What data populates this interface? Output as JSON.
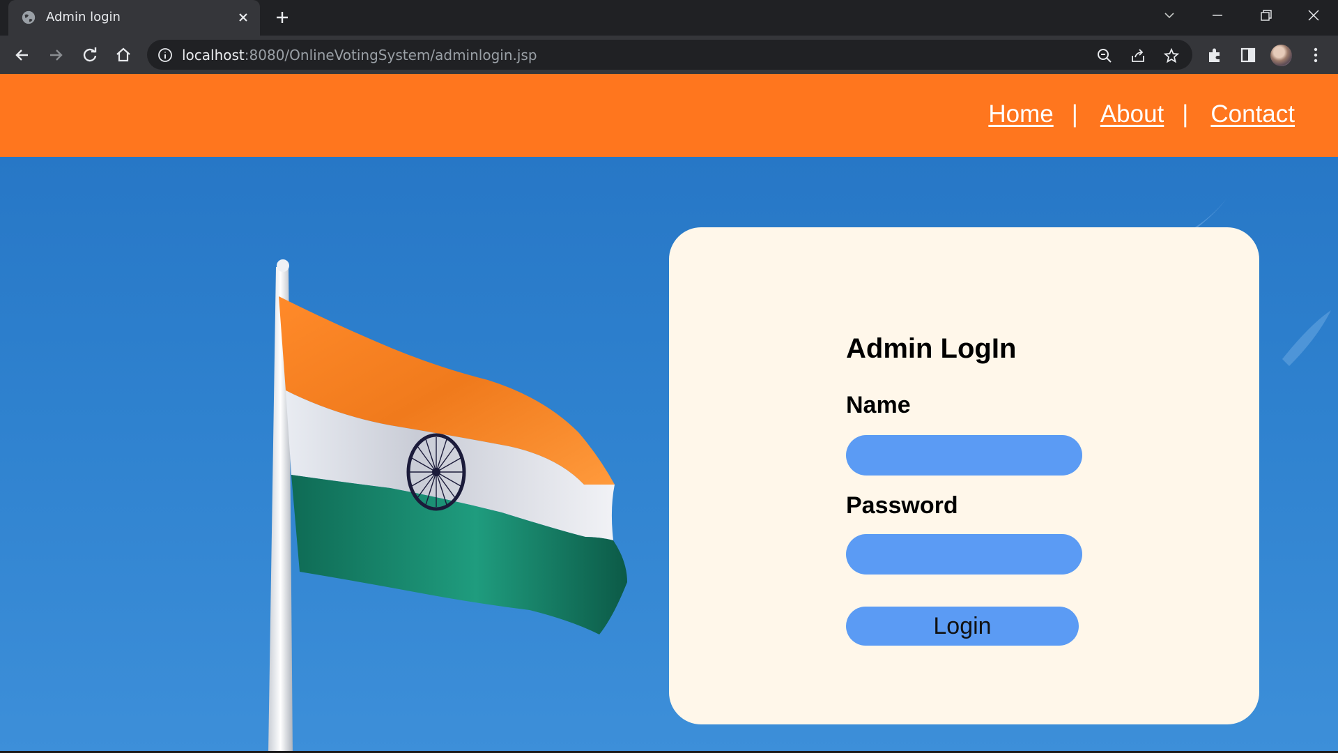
{
  "browser": {
    "tab_title": "Admin login",
    "url_host": "localhost",
    "url_rest": ":8080/OnlineVotingSystem/adminlogin.jsp"
  },
  "nav": {
    "home": "Home",
    "about": "About",
    "contact": "Contact",
    "separator": "|"
  },
  "login_form": {
    "title": "Admin LogIn",
    "name_label": "Name",
    "name_value": "",
    "password_label": "Password",
    "password_value": "",
    "submit_label": "Login"
  },
  "colors": {
    "navbar": "#ff761e",
    "sky": "#2f82cf",
    "card": "#fff7ea",
    "field": "#5b9bf4"
  }
}
